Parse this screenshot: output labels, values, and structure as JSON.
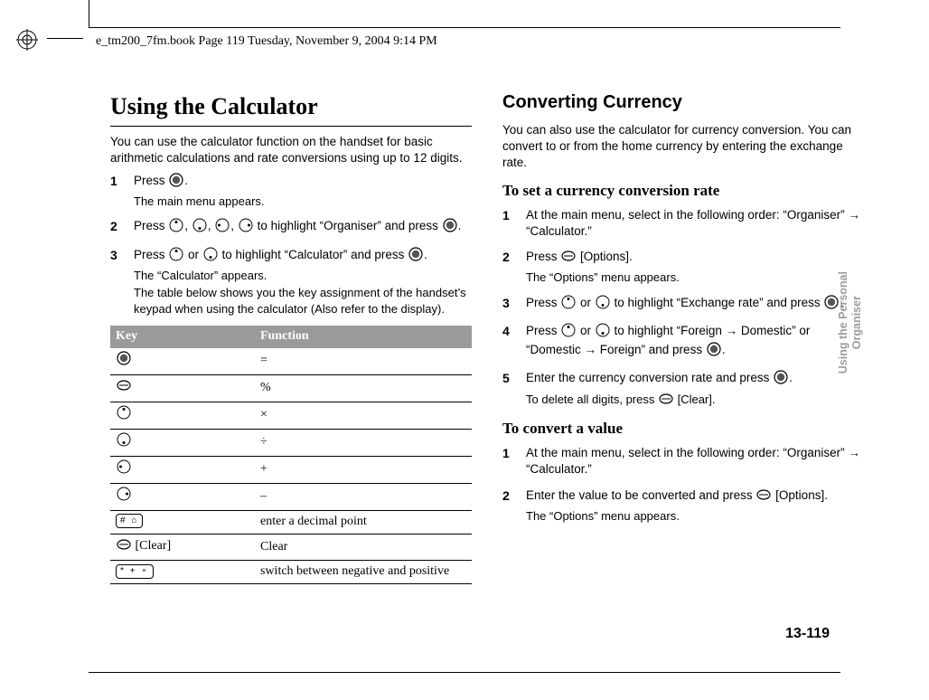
{
  "running_head": "e_tm200_7fm.book  Page 119  Tuesday, November 9, 2004  9:14 PM",
  "side_tab_line1": "Using the Personal",
  "side_tab_line2": "Organiser",
  "page_number": "13-119",
  "left": {
    "h1": "Using the Calculator",
    "intro": "You can use the calculator function on the handset for basic arithmetic calculations and rate conversions using up to 12 digits.",
    "steps": [
      {
        "n": "1",
        "main_pre": "Press ",
        "icons": [
          "center"
        ],
        "main_post": ".",
        "sub": "The main menu appears."
      },
      {
        "n": "2",
        "main_pre": "Press ",
        "icons": [
          "up",
          "down",
          "left",
          "right"
        ],
        "main_mid": " to highlight “Organiser” and press ",
        "icons2": [
          "center"
        ],
        "main_post": ".",
        "sub": ""
      },
      {
        "n": "3",
        "main_pre": "Press ",
        "icons": [
          "up",
          "down-or"
        ],
        "main_mid": " to highlight “Calculator” and press ",
        "icons2": [
          "center"
        ],
        "main_post": ".",
        "sub": "The “Calculator” appears.",
        "sub2": "The table below shows you the key assignment of the handset’s keypad when using the calculator (Also refer to the display)."
      }
    ],
    "table": {
      "headers": [
        "Key",
        "Function"
      ],
      "rows": [
        {
          "key_type": "center",
          "key_label": "",
          "fn": "="
        },
        {
          "key_type": "soft",
          "key_label": "",
          "fn": "%"
        },
        {
          "key_type": "up",
          "key_label": "",
          "fn": "×"
        },
        {
          "key_type": "down",
          "key_label": "",
          "fn": "÷"
        },
        {
          "key_type": "left",
          "key_label": "",
          "fn": "+"
        },
        {
          "key_type": "right",
          "key_label": "",
          "fn": "–"
        },
        {
          "key_type": "chip",
          "key_label": "# ⌂",
          "fn": "enter a decimal point"
        },
        {
          "key_type": "soft-label",
          "key_label": "[Clear]",
          "fn": "Clear"
        },
        {
          "key_type": "chip",
          "key_label": "* + ∘",
          "fn": "switch between negative and positive"
        }
      ]
    }
  },
  "right": {
    "h2": "Converting Currency",
    "intro": "You can also use the calculator for currency conversion. You can convert to or from the home currency by entering the exchange rate.",
    "h3a": "To set a currency conversion rate",
    "stepsA": [
      {
        "n": "1",
        "text_pre": "At the main menu, select in the following order: “Organiser” ",
        "arrow": true,
        "text_post": " “Calculator.”"
      },
      {
        "n": "2",
        "text_pre": "Press ",
        "icon": "soft",
        "text_mid": " [Options].",
        "sub": "The “Options” menu appears."
      },
      {
        "n": "3",
        "text_pre": "Press ",
        "icons": [
          "up",
          "down-or"
        ],
        "text_mid": " to highlight “Exchange rate” and press ",
        "icon2": "center",
        "text_post": "."
      },
      {
        "n": "4",
        "text_pre": "Press ",
        "icons": [
          "up",
          "down-or"
        ],
        "text_mid": " to highlight “Foreign ",
        "arrow_mid": true,
        "text_mid2": " Domestic” or “Domestic ",
        "arrow_mid2": true,
        "text_mid3": " Foreign” and press ",
        "icon2": "center",
        "text_post": "."
      },
      {
        "n": "5",
        "text_pre": "Enter the currency conversion rate and press ",
        "icon": "center",
        "text_post": ".",
        "sub_pre": "To delete all digits, press ",
        "sub_icon": "soft",
        "sub_post": " [Clear]."
      }
    ],
    "h3b": "To convert a value",
    "stepsB": [
      {
        "n": "1",
        "text_pre": "At the main menu, select in the following order: “Organiser” ",
        "arrow": true,
        "text_post": " “Calculator.”"
      },
      {
        "n": "2",
        "text_pre": "Enter the value to be converted and press ",
        "icon": "soft",
        "text_post": " [Options].",
        "sub": "The “Options” menu appears."
      }
    ]
  }
}
